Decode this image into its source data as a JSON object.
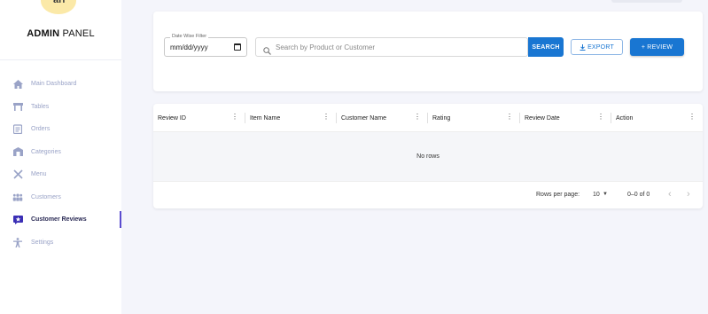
{
  "sidebar": {
    "logo_text": "arr",
    "brand_bold": "ADMIN",
    "brand_rest": " PANEL",
    "items": [
      {
        "label": "Main Dashboard",
        "icon": "home-icon"
      },
      {
        "label": "Tables",
        "icon": "table-icon"
      },
      {
        "label": "Orders",
        "icon": "orders-icon"
      },
      {
        "label": "Categories",
        "icon": "categories-icon"
      },
      {
        "label": "Menu",
        "icon": "utensils-icon"
      },
      {
        "label": "Customers",
        "icon": "users-icon"
      },
      {
        "label": "Customer Reviews",
        "icon": "review-icon",
        "active": true
      },
      {
        "label": "Settings",
        "icon": "settings-icon"
      }
    ]
  },
  "filters": {
    "date_legend": "Date Wise Filter",
    "date_value": "mm/dd/yyyy",
    "search_placeholder": "Search by Product or Customer",
    "search_button": "SEARCH",
    "export_button": "EXPORT",
    "review_button": "+ REVIEW"
  },
  "table": {
    "columns": [
      "Review ID",
      "Item Name",
      "Customer Name",
      "Rating",
      "Review Date",
      "Action"
    ],
    "empty_text": "No rows",
    "rows_per_page_label": "Rows per page:",
    "rows_per_page_value": "10",
    "range_text": "0–0 of 0"
  },
  "colors": {
    "accent": "#1976d2",
    "active_indicator": "#5b4ccf",
    "sidebar_text": "#9aa3c7",
    "background": "#f4f5fb"
  }
}
